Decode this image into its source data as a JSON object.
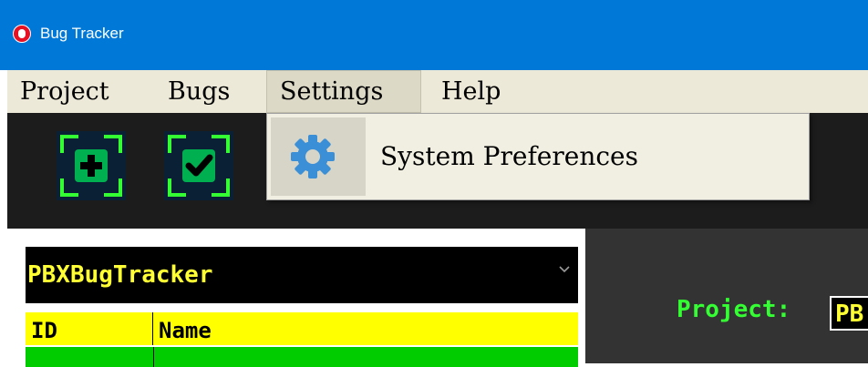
{
  "window": {
    "title": "Bug Tracker",
    "icon": "bug-icon"
  },
  "menu": {
    "project": "Project",
    "bugs": "Bugs",
    "settings": "Settings",
    "help": "Help"
  },
  "settings_menu": {
    "items": [
      {
        "label": "System Preferences",
        "icon": "gear-icon"
      }
    ]
  },
  "toolbar": {
    "buttons": [
      {
        "icon": "add-icon"
      },
      {
        "icon": "check-icon"
      },
      {
        "icon": "unknown-icon"
      },
      {
        "icon": "unknown-icon"
      }
    ]
  },
  "project_selector": {
    "value": "PBXBugTracker"
  },
  "bug_grid": {
    "columns": [
      "ID",
      "Name"
    ]
  },
  "details": {
    "project_label": "Project:",
    "project_value": "PB"
  },
  "colors": {
    "titlebar": "#0078d7",
    "menubar": "#ece9d8",
    "toolbar": "#1c1c1c",
    "accent_green": "#33ff33",
    "accent_yellow": "#ffff33",
    "grid_header": "#ffff00",
    "grid_row": "#00cc00"
  }
}
